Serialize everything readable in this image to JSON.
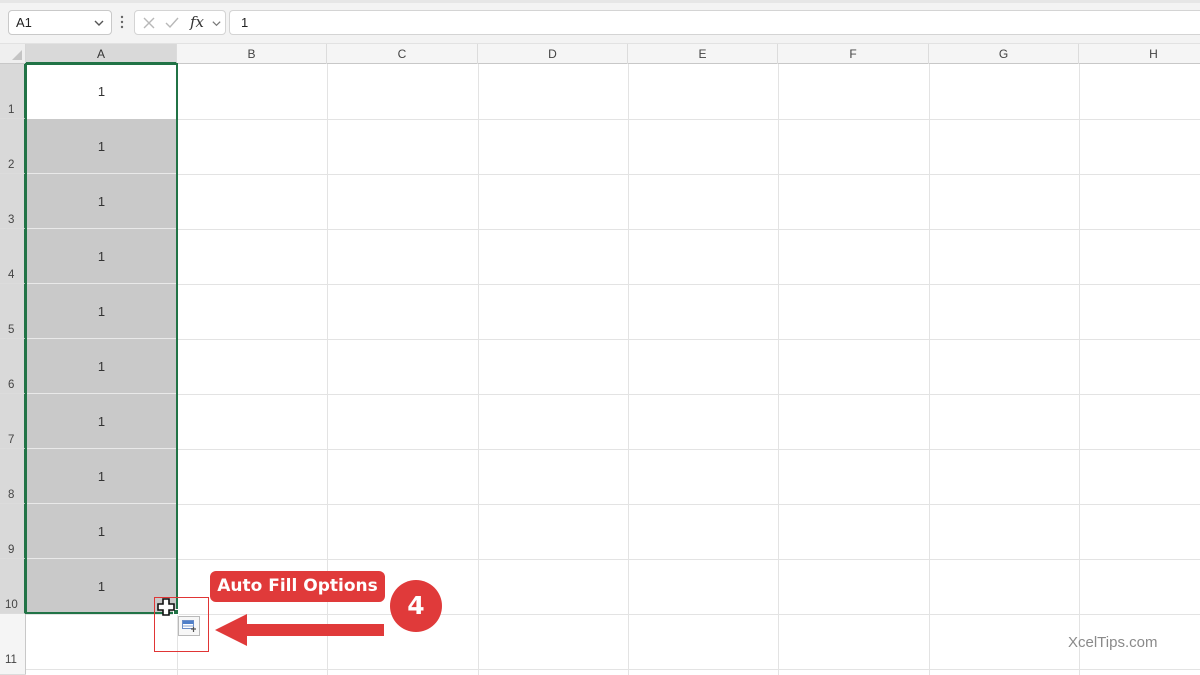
{
  "formula_bar": {
    "name_box": "A1",
    "fx_label": "fx",
    "formula_value": "1"
  },
  "columns": [
    "A",
    "B",
    "C",
    "D",
    "E",
    "F",
    "G",
    "H"
  ],
  "rows": [
    "1",
    "2",
    "3",
    "4",
    "5",
    "6",
    "7",
    "8",
    "9",
    "10",
    "11"
  ],
  "column_a_values": [
    "1",
    "1",
    "1",
    "1",
    "1",
    "1",
    "1",
    "1",
    "1",
    "1"
  ],
  "selection": {
    "range_start": "A1",
    "range_end": "A10",
    "accent_color": "#217346",
    "fill_color": "#c9c9c9"
  },
  "annotation": {
    "label": "Auto Fill Options",
    "step": "4",
    "color": "#e03a3a",
    "icon": "auto-fill-options-icon"
  },
  "watermark": "XcelTips.com"
}
